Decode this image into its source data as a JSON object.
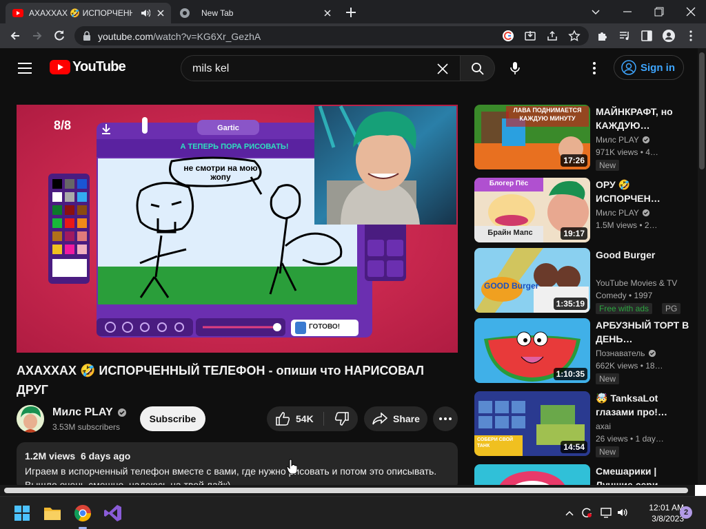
{
  "browser": {
    "tabs": [
      {
        "title": "АХАХХАХ 🤣 ИСПОРЧЕННЫ",
        "icon": "youtube-icon",
        "audio": true,
        "active": true
      },
      {
        "title": "New Tab",
        "icon": "chrome-icon",
        "active": false
      }
    ],
    "url_host": "youtube.com",
    "url_path": "/watch?v=KG6Xr_GezhA"
  },
  "youtube": {
    "logo_text": "YouTube",
    "search_value": "mils kel",
    "signin_label": "Sign in"
  },
  "player": {
    "counter": "8/8",
    "game_logo": "Gartic",
    "prompt": "А ТЕПЕРЬ ПОРА РИСОВАТЬ!",
    "speech": "не смотри на мою жопу",
    "done_label": "ГОТОВО!"
  },
  "video": {
    "title": "АХАХХАХ 🤣 ИСПОРЧЕННЫЙ ТЕЛЕФОН - опиши что НАРИСОВАЛ ДРУГ",
    "channel": "Милс PLAY",
    "subscribers": "3.53M subscribers",
    "subscribe_label": "Subscribe",
    "likes": "54K",
    "share_label": "Share",
    "views": "1.2M views",
    "age": "6 days ago",
    "desc_line1": "Играем в испорченный телефон вместе с вами, где нужно рисовать и потом это описывать.",
    "desc_line2": "Вышло очень смешно, надеюсь на твой лайк)"
  },
  "sidebar": [
    {
      "title": "МАЙНКРАФТ, но КАЖДУЮ…",
      "channel": "Милс PLAY",
      "verified": true,
      "meta": "971K views • 4…",
      "badge": "New",
      "duration": "17:26",
      "thumb_text": "ЛАВА ПОДНИМАЕТСЯ КАЖДУЮ МИНУТУ"
    },
    {
      "title": "ОРУ 🤣 ИСПОРЧЕН…",
      "channel": "Милс PLAY",
      "verified": true,
      "meta": "1.5M views • 2…",
      "badge": "",
      "duration": "19:17",
      "thumb_text": "Блогер Пёс",
      "thumb_text2": "Брайн Мапс"
    },
    {
      "title": "Good Burger",
      "channel": "YouTube Movies & TV",
      "verified": false,
      "meta": "Comedy • 1997",
      "badge": "",
      "free": "Free with ads",
      "rating": "PG",
      "duration": "1:35:19",
      "thumb_text": "GOOD Burger"
    },
    {
      "title": "АРБУЗНЫЙ ТОРТ В ДЕНЬ…",
      "channel": "Познаватель",
      "verified": true,
      "meta": "662K views • 18…",
      "badge": "New",
      "duration": "1:10:35"
    },
    {
      "title": "🤯 TanksaLot глазами про!…",
      "channel": "axai",
      "verified": false,
      "meta": "26 views • 1 day…",
      "badge": "New",
      "duration": "14:54",
      "thumb_text": "СОБЕРИ СВОЙ ТАНК"
    },
    {
      "title": "Смешарики | Лучшие сери…",
      "channel": "",
      "verified": false,
      "meta": "",
      "badge": "",
      "duration": ""
    }
  ],
  "taskbar": {
    "time": "12:01 AM",
    "date": "3/8/2023",
    "notifications": "2"
  },
  "colors": {
    "yt_red": "#ff0000",
    "link_blue": "#3ea6ff",
    "player_bg": "#c8234a"
  }
}
